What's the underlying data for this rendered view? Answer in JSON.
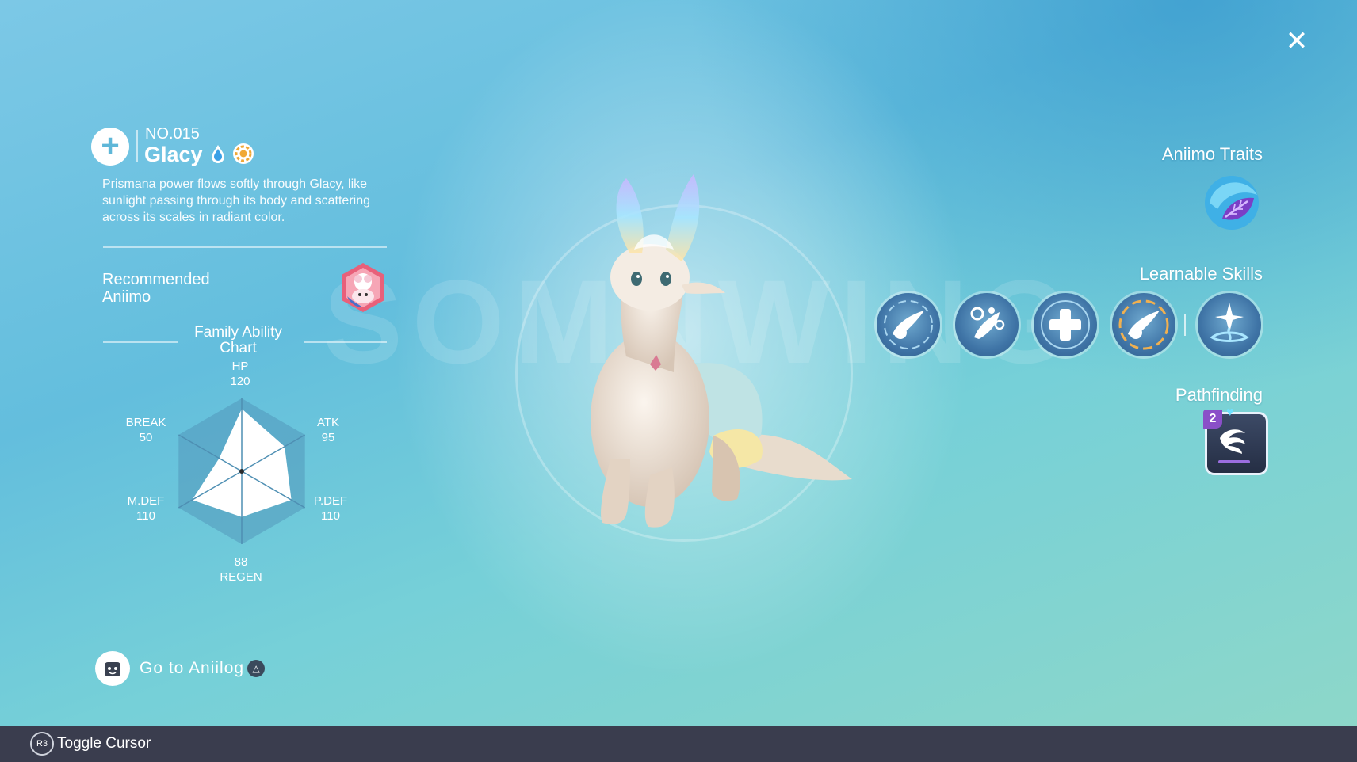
{
  "header": {
    "close_icon": "close-icon"
  },
  "creature": {
    "number": "NO.015",
    "name": "Glacy",
    "elements": [
      "water-drop-icon",
      "sun-gear-icon"
    ],
    "description": "Prismana power flows softly through Glacy, like sunlight passing through its body and scattering across its scales in radiant color."
  },
  "recommended": {
    "title": "Recommended Aniimo"
  },
  "family_chart": {
    "title": "Family Ability Chart",
    "stats": [
      {
        "label": "HP",
        "value": "120"
      },
      {
        "label": "ATK",
        "value": "95"
      },
      {
        "label": "P.DEF",
        "value": "110"
      },
      {
        "label": "REGEN",
        "value": "88"
      },
      {
        "label": "M.DEF",
        "value": "110"
      },
      {
        "label": "BREAK",
        "value": "50"
      }
    ],
    "max": 140,
    "fill_color": "#ffffff",
    "frame_color": "#4e8fb3"
  },
  "watermark": "SOMNWING",
  "aniilog": {
    "label": "Go to Aniilog",
    "button_glyph": "△"
  },
  "right": {
    "traits_title": "Aniimo Traits",
    "skills_title": "Learnable Skills",
    "pathfinding_title": "Pathfinding",
    "pathfinding_level": "2",
    "skills": [
      "comet-skill-icon",
      "bubble-skill-icon",
      "heal-skill-icon",
      "flame-comet-skill-icon",
      "ice-burst-skill-icon"
    ]
  },
  "footer": {
    "toggle_label": "Toggle Cursor",
    "toggle_button": "R3"
  }
}
